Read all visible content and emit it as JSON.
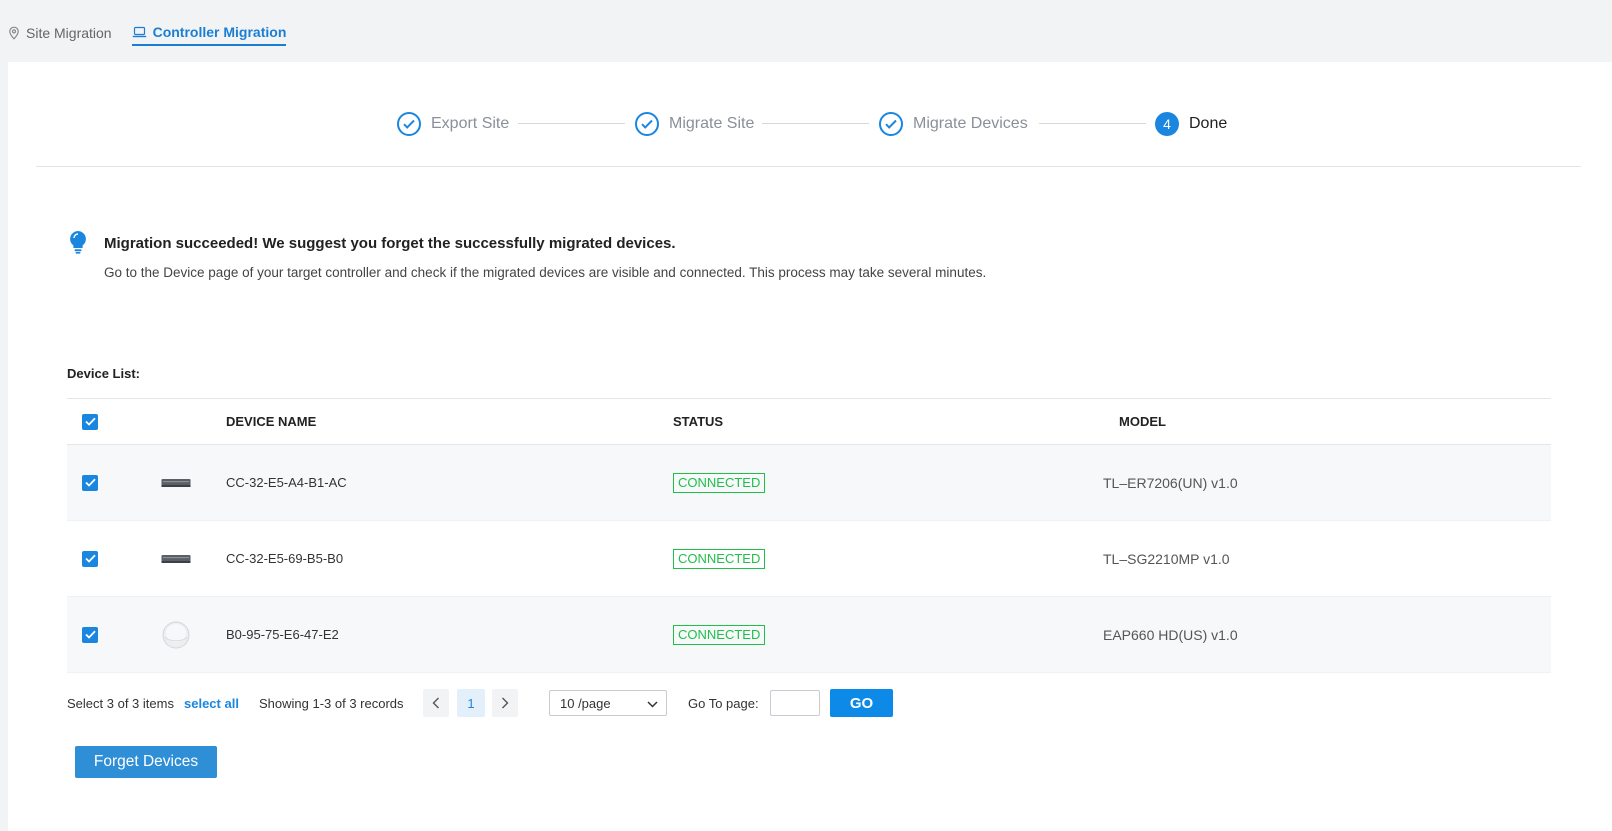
{
  "tabs": [
    {
      "label": "Site Migration",
      "icon": "location-pin-icon",
      "active": false
    },
    {
      "label": "Controller Migration",
      "icon": "laptop-icon",
      "active": true
    }
  ],
  "steps": [
    {
      "label": "Export Site",
      "state": "done"
    },
    {
      "label": "Migrate Site",
      "state": "done"
    },
    {
      "label": "Migrate Devices",
      "state": "done"
    },
    {
      "label": "Done",
      "state": "current",
      "number": "4"
    }
  ],
  "notice": {
    "icon": "lightbulb-icon",
    "title": "Migration succeeded! We suggest you forget the successfully migrated devices.",
    "description": "Go to the Device page of your target controller and check if the migrated devices are visible and connected. This process may take several minutes."
  },
  "device_list": {
    "label": "Device List:",
    "columns": [
      "DEVICE NAME",
      "STATUS",
      "MODEL"
    ],
    "rows": [
      {
        "name": "CC-32-E5-A4-B1-AC",
        "status": "CONNECTED",
        "model": "TL–ER7206(UN) v1.0",
        "device_icon": "router-icon",
        "checked": true
      },
      {
        "name": "CC-32-E5-69-B5-B0",
        "status": "CONNECTED",
        "model": "TL–SG2210MP v1.0",
        "device_icon": "switch-icon",
        "checked": true
      },
      {
        "name": "B0-95-75-E6-47-E2",
        "status": "CONNECTED",
        "model": "EAP660 HD(US) v1.0",
        "device_icon": "access-point-icon",
        "checked": true
      }
    ]
  },
  "pagination": {
    "selected_text": "Select 3 of 3 items",
    "select_all_label": "select all",
    "showing_text": "Showing 1-3 of 3 records",
    "current_page": "1",
    "page_size": "10 /page",
    "goto_label": "Go To page:",
    "go_label": "GO"
  },
  "forget_button": "Forget Devices",
  "colors": {
    "accent": "#1a86e0",
    "success": "#1fbf4a"
  }
}
